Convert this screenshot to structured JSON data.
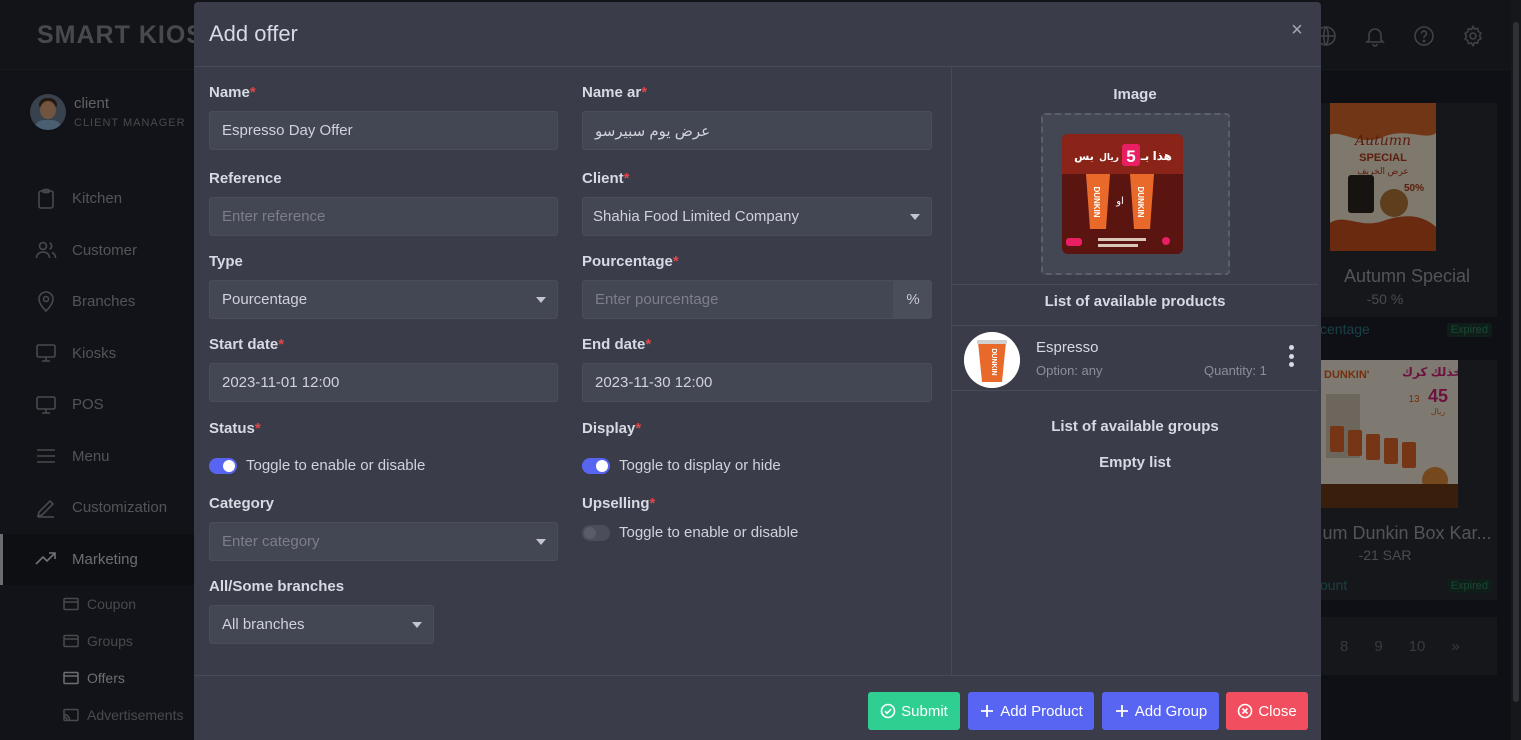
{
  "app": {
    "brand": "SMART KIOS",
    "user": {
      "name": "client",
      "role": "CLIENT MANAGER"
    }
  },
  "sidebar": {
    "items": [
      {
        "label": "Kitchen",
        "icon": "clipboard-icon"
      },
      {
        "label": "Customer",
        "icon": "users-icon"
      },
      {
        "label": "Branches",
        "icon": "map-pin-icon"
      },
      {
        "label": "Kiosks",
        "icon": "monitor-icon"
      },
      {
        "label": "POS",
        "icon": "monitor-icon"
      },
      {
        "label": "Menu",
        "icon": "menu-icon"
      },
      {
        "label": "Customization",
        "icon": "pen-icon"
      },
      {
        "label": "Marketing",
        "icon": "trending-up-icon",
        "active": true
      }
    ],
    "subitems": [
      {
        "label": "Coupon"
      },
      {
        "label": "Groups"
      },
      {
        "label": "Offers",
        "current": true
      },
      {
        "label": "Advertisements"
      }
    ]
  },
  "background_cards": [
    {
      "title": "Autumn Special",
      "value": "-50 %",
      "type": "centage",
      "badge": "Expired",
      "image_text": [
        "Autumn",
        "SPECIAL",
        "عرض الخريف",
        "50%"
      ]
    },
    {
      "title": "um Dunkin Box Kar...",
      "value": "-21 SAR",
      "type": "ount",
      "badge": "Expired",
      "image_text": [
        "DUNKIN'",
        "خذلك كرك",
        "45",
        "13",
        "ريال"
      ]
    }
  ],
  "pagination": [
    "8",
    "9",
    "10",
    "»"
  ],
  "modal": {
    "title": "Add offer",
    "fields": {
      "name": {
        "label": "Name",
        "value": "Espresso Day Offer"
      },
      "name_ar": {
        "label": "Name ar",
        "value": "عرض يوم سبيرسو"
      },
      "reference": {
        "label": "Reference",
        "placeholder": "Enter reference"
      },
      "client": {
        "label": "Client",
        "value": "Shahia Food Limited Company"
      },
      "type": {
        "label": "Type",
        "value": "Pourcentage"
      },
      "pourcentage": {
        "label": "Pourcentage",
        "placeholder": "Enter pourcentage",
        "addon": "%"
      },
      "start_date": {
        "label": "Start date",
        "value": "2023-11-01 12:00"
      },
      "end_date": {
        "label": "End date",
        "value": "2023-11-30 12:00"
      },
      "status": {
        "label": "Status",
        "toggle_text": "Toggle to enable or disable",
        "on": true
      },
      "display": {
        "label": "Display",
        "toggle_text": "Toggle to display or hide",
        "on": true
      },
      "category": {
        "label": "Category",
        "placeholder": "Enter category"
      },
      "upselling": {
        "label": "Upselling",
        "toggle_text": "Toggle to enable or disable",
        "on": false
      },
      "branches": {
        "label": "All/Some branches",
        "value": "All branches"
      }
    },
    "image_section": {
      "title": "Image",
      "promo_text": [
        "هذا بـ",
        "5",
        "ريال",
        "بس",
        "DUNKIN",
        "او"
      ]
    },
    "products": {
      "title": "List of available products",
      "items": [
        {
          "name": "Espresso",
          "option": "Option: any",
          "quantity": "Quantity: 1"
        }
      ]
    },
    "groups": {
      "title": "List of available groups",
      "empty": "Empty list"
    },
    "footer": {
      "submit": "Submit",
      "add_product": "Add Product",
      "add_group": "Add Group",
      "close": "Close"
    }
  },
  "colors": {
    "primary": "#5865f2",
    "success": "#2fcf92",
    "danger": "#f14f5f",
    "modal_bg": "#3a3d49"
  }
}
